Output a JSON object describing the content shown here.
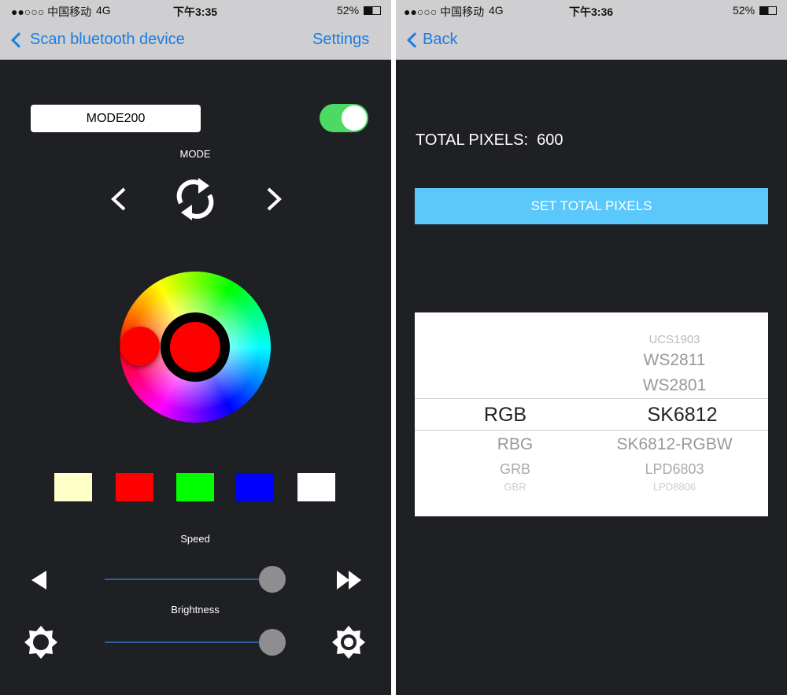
{
  "left": {
    "status": {
      "carrier": "●●○○○ 中国移动",
      "network": "4G",
      "time": "下午3:35",
      "battery": "52%"
    },
    "nav": {
      "back_label": "Scan bluetooth device",
      "settings_label": "Settings"
    },
    "mode_field": "MODE200",
    "power_on": true,
    "mode_label": "MODE",
    "selected_color": "#ff0000",
    "swatches": [
      "#ffffc8",
      "#ff0000",
      "#00ff00",
      "#0000ff",
      "#ffffff"
    ],
    "speed_label": "Speed",
    "speed_value": 1.0,
    "brightness_label": "Brightness",
    "brightness_value": 1.0
  },
  "right": {
    "status": {
      "carrier": "●●○○○ 中国移动",
      "network": "4G",
      "time": "下午3:36",
      "battery": "52%"
    },
    "nav": {
      "back_label": "Back"
    },
    "total_pixels_label": "TOTAL PIXELS:",
    "total_pixels_value": "600",
    "set_button": "SET TOTAL PIXELS",
    "picker": {
      "order": {
        "selected": "RGB",
        "below": [
          "RBG",
          "GRB",
          "GBR"
        ]
      },
      "chip": {
        "above": [
          "UCS1903",
          "WS2811",
          "WS2801"
        ],
        "selected": "SK6812",
        "below": [
          "SK6812-RGBW",
          "LPD6803",
          "LPD8806"
        ]
      }
    }
  }
}
